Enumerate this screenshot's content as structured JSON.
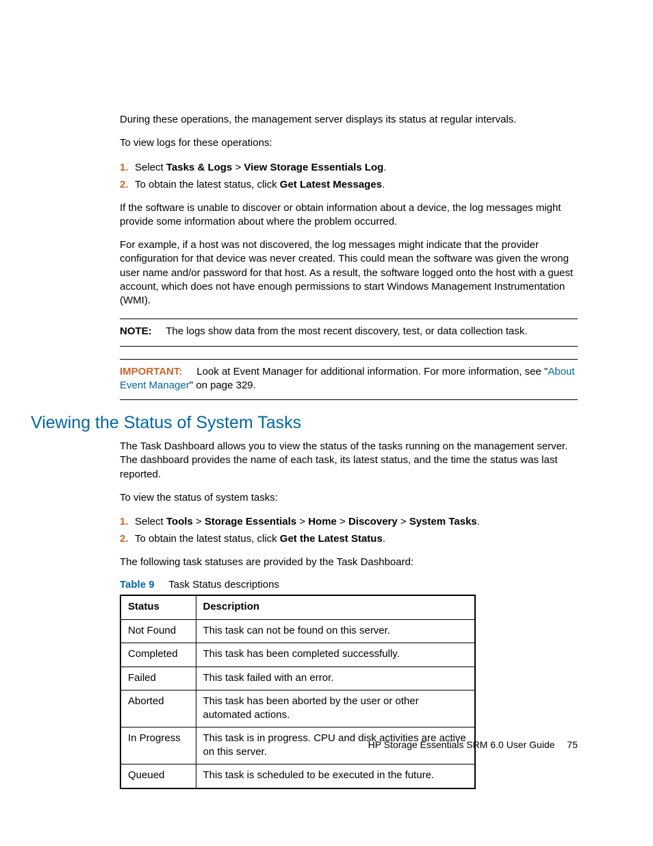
{
  "intro": {
    "p1": "During these operations, the management server displays its status at regular intervals.",
    "p2": "To view logs for these operations:"
  },
  "steps1": {
    "i1": {
      "num": "1.",
      "prefix": "Select ",
      "b1": "Tasks & Logs",
      "sep": " > ",
      "b2": "View Storage Essentials Log",
      "suffix": "."
    },
    "i2": {
      "num": "2.",
      "prefix": "To obtain the latest status, click ",
      "b1": "Get Latest Messages",
      "suffix": "."
    }
  },
  "para_unable": "If the software is unable to discover or obtain information about a device, the log messages might provide some information about where the problem occurred.",
  "para_example": "For example, if a host was not discovered, the log messages might indicate that the provider configuration for that device was never created. This could mean the software was given the wrong user name and/or password for that host. As a result, the software logged onto the host with a guest account, which does not have enough permissions to start Windows Management Instrumentation (WMI).",
  "note": {
    "label": "NOTE:",
    "text": "The logs show data from the most recent discovery, test, or data collection task."
  },
  "important": {
    "label": "IMPORTANT:",
    "text_before": "Look at Event Manager for additional information. For more information, see \"",
    "link": "About Event Manager",
    "text_after": "\" on page 329."
  },
  "section_heading": "Viewing the Status of System Tasks",
  "section_body": {
    "p1": "The Task Dashboard allows you to view the status of the tasks running on the management server. The dashboard provides the name of each task, its latest status, and the time the  status was last reported.",
    "p2": "To view the status of system tasks:"
  },
  "steps2": {
    "i1": {
      "num": "1.",
      "prefix": "Select ",
      "b1": "Tools",
      "sep": " > ",
      "b2": "Storage Essentials",
      "b3": "Home",
      "b4": "Discovery",
      "b5": "System Tasks",
      "suffix": "."
    },
    "i2": {
      "num": "2.",
      "prefix": "To obtain the latest status, click ",
      "b1": "Get the Latest Status",
      "suffix": "."
    }
  },
  "para_following": "The following task statuses are provided by the Task Dashboard:",
  "table": {
    "caption_label": "Table 9",
    "caption_text": "Task Status descriptions",
    "headers": {
      "c1": "Status",
      "c2": "Description"
    },
    "rows": [
      {
        "status": "Not Found",
        "desc": "This task can not be found on this server."
      },
      {
        "status": "Completed",
        "desc": "This task has been completed successfully."
      },
      {
        "status": "Failed",
        "desc": "This task failed with an error."
      },
      {
        "status": "Aborted",
        "desc": "This task has been aborted by the user or other automated actions."
      },
      {
        "status": "In Progress",
        "desc": "This task is in progress. CPU and disk activities are active on this server."
      },
      {
        "status": "Queued",
        "desc": "This task is scheduled to be executed in the future."
      }
    ]
  },
  "footer": {
    "title": "HP Storage Essentials SRM 6.0 User Guide",
    "page": "75"
  }
}
